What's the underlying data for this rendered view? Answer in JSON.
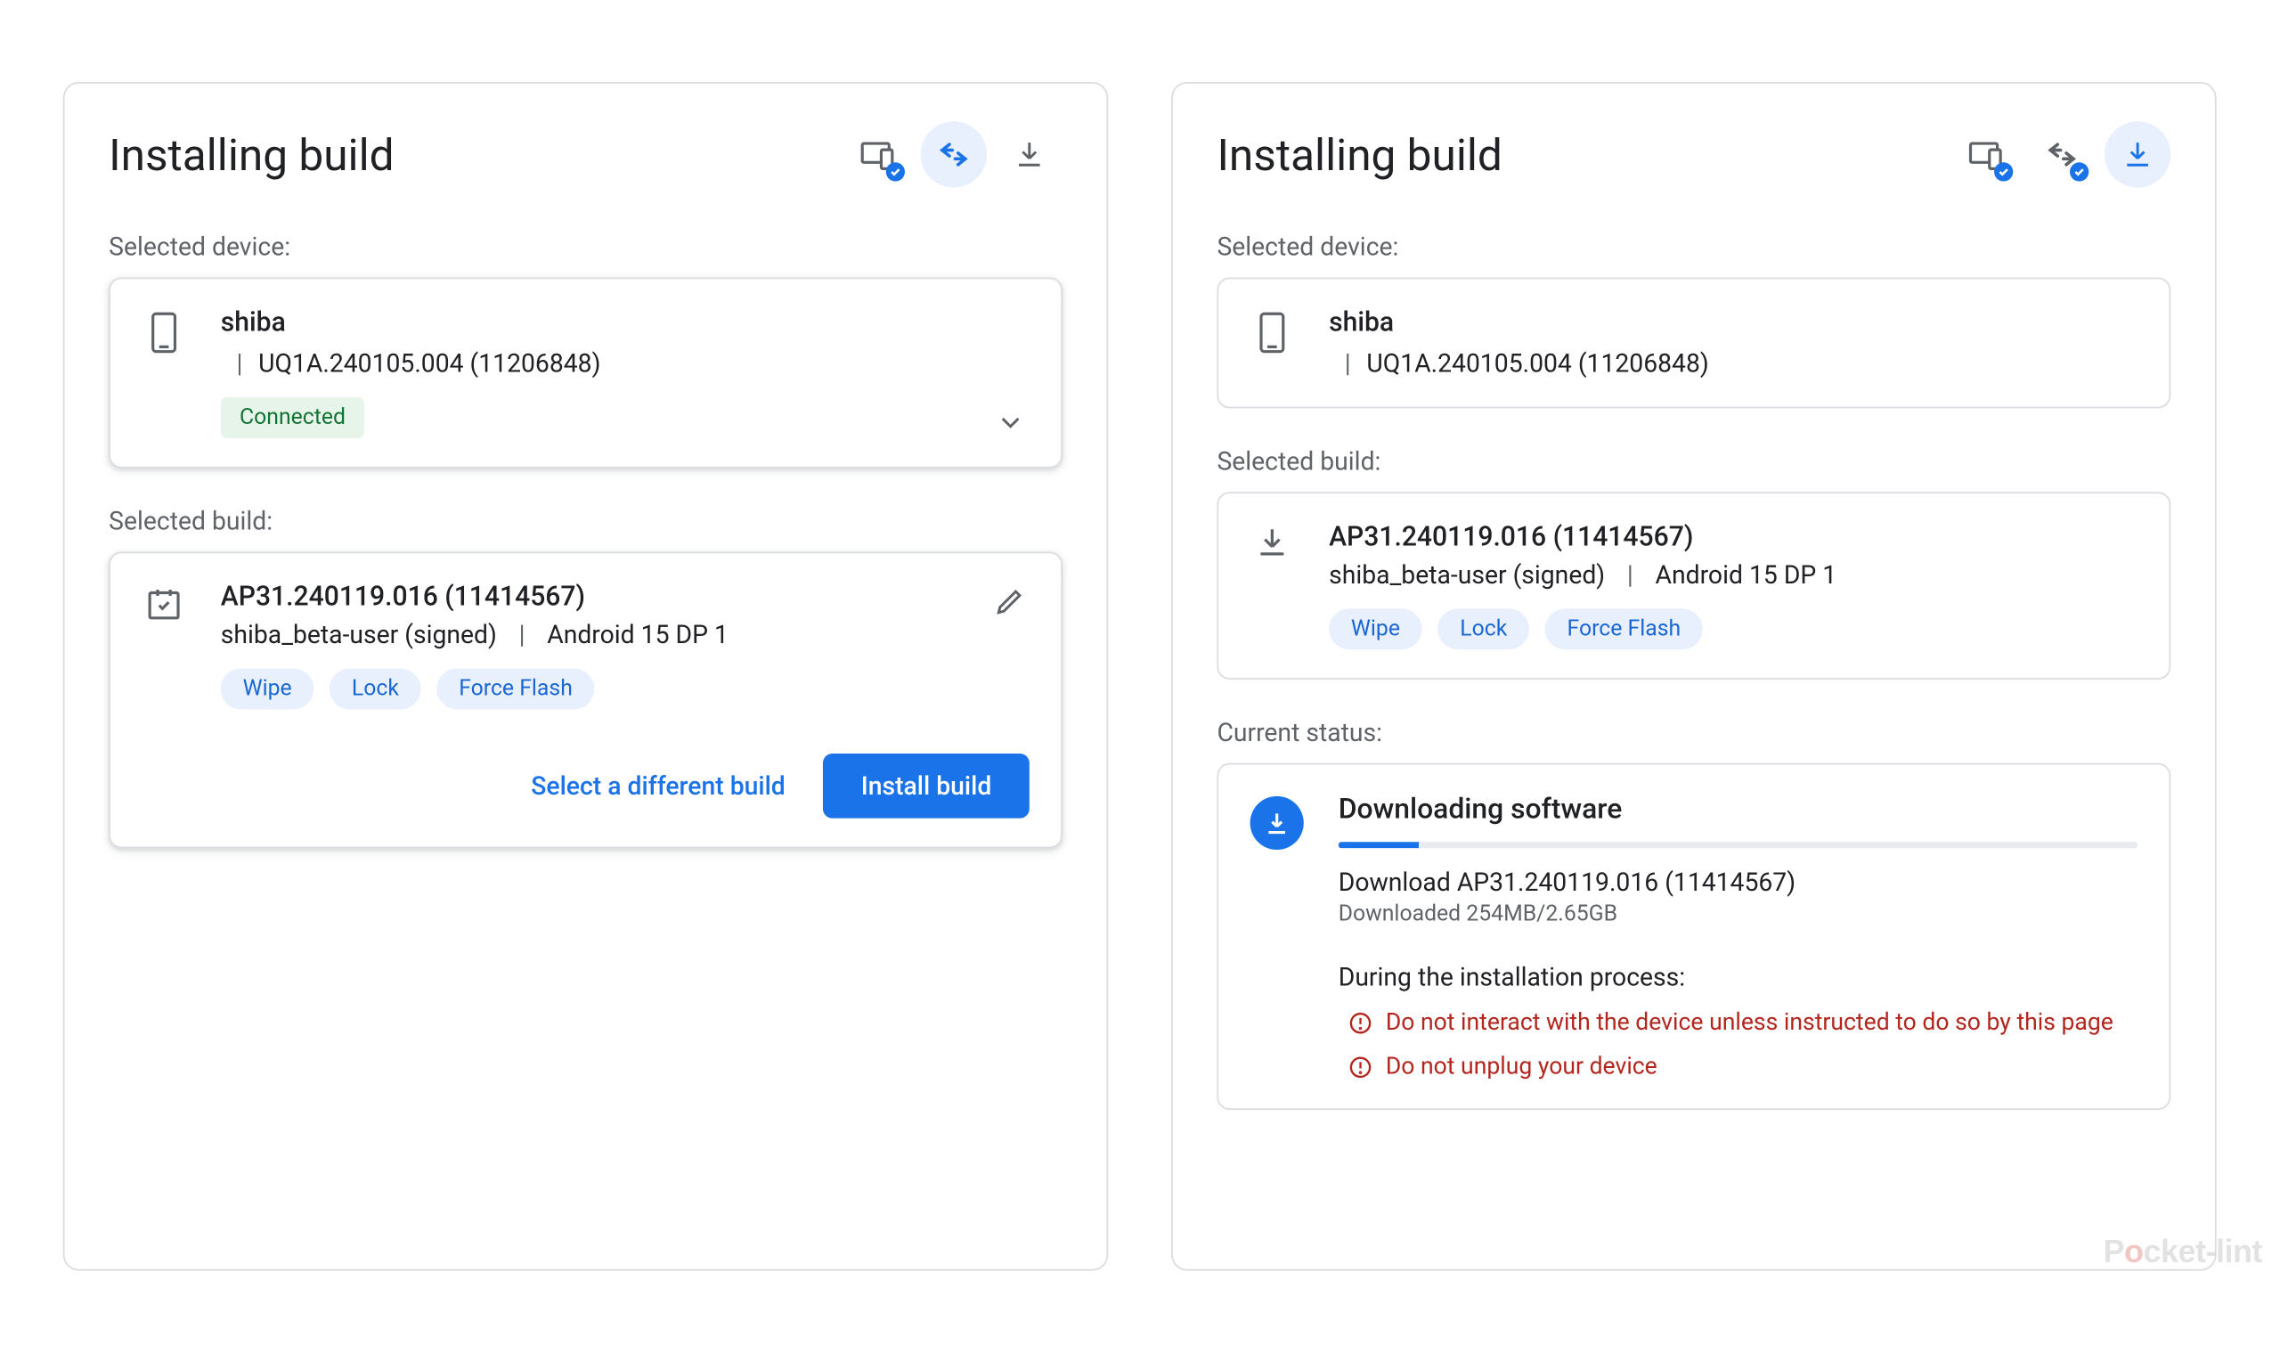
{
  "watermark": "Pocket-lint",
  "left": {
    "title": "Installing build",
    "sections": {
      "device_label": "Selected device:",
      "build_label": "Selected build:"
    },
    "device": {
      "name": "shiba",
      "build": "UQ1A.240105.004 (11206848)",
      "status": "Connected"
    },
    "build": {
      "id": "AP31.240119.016 (11414567)",
      "variant": "shiba_beta-user (signed)",
      "target": "Android 15 DP 1",
      "chips": [
        "Wipe",
        "Lock",
        "Force Flash"
      ]
    },
    "actions": {
      "select_different": "Select a different build",
      "install": "Install build"
    }
  },
  "right": {
    "title": "Installing build",
    "sections": {
      "device_label": "Selected device:",
      "build_label": "Selected build:",
      "status_label": "Current status:"
    },
    "device": {
      "name": "shiba",
      "build": "UQ1A.240105.004 (11206848)"
    },
    "build": {
      "id": "AP31.240119.016 (11414567)",
      "variant": "shiba_beta-user (signed)",
      "target": "Android 15 DP 1",
      "chips": [
        "Wipe",
        "Lock",
        "Force Flash"
      ]
    },
    "status": {
      "title": "Downloading software",
      "download_line": "Download AP31.240119.016 (11414567)",
      "downloaded": "Downloaded 254MB/2.65GB",
      "progress_percent": 10,
      "warning_heading": "During the installation process:",
      "warnings": [
        "Do not interact with the device unless instructed to do so by this page",
        "Do not unplug your device"
      ]
    }
  }
}
